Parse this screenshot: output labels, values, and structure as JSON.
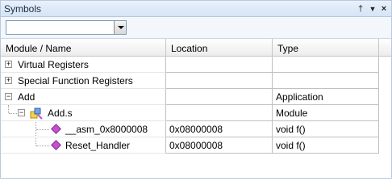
{
  "panel": {
    "title": "Symbols",
    "buttons": {
      "pin_glyph": "†",
      "dock_glyph": "▼",
      "close_glyph": "×"
    }
  },
  "toolbar": {
    "combo_value": ""
  },
  "grid": {
    "headers": [
      "Module / Name",
      "Location",
      "Type"
    ],
    "rows": [
      {
        "expander": "+",
        "name": "Virtual Registers",
        "location": "",
        "type": ""
      },
      {
        "expander": "+",
        "name": "Special Function Registers",
        "location": "",
        "type": ""
      },
      {
        "expander": "−",
        "name": "Add",
        "location": "",
        "type": "Application"
      },
      {
        "expander": "−",
        "name": "Add.s",
        "location": "",
        "type": "Module",
        "icon": "module-icon"
      },
      {
        "name": "__asm_0x8000008",
        "location": "0x08000008",
        "type": "void f()",
        "icon": "function-icon"
      },
      {
        "name": "Reset_Handler",
        "location": "0x08000008",
        "type": "void f()",
        "icon": "function-icon"
      }
    ]
  },
  "colors": {
    "title_bar": "#d6e4f5",
    "function_icon": "#c64fd0",
    "grid_line": "#c0c0c0"
  }
}
